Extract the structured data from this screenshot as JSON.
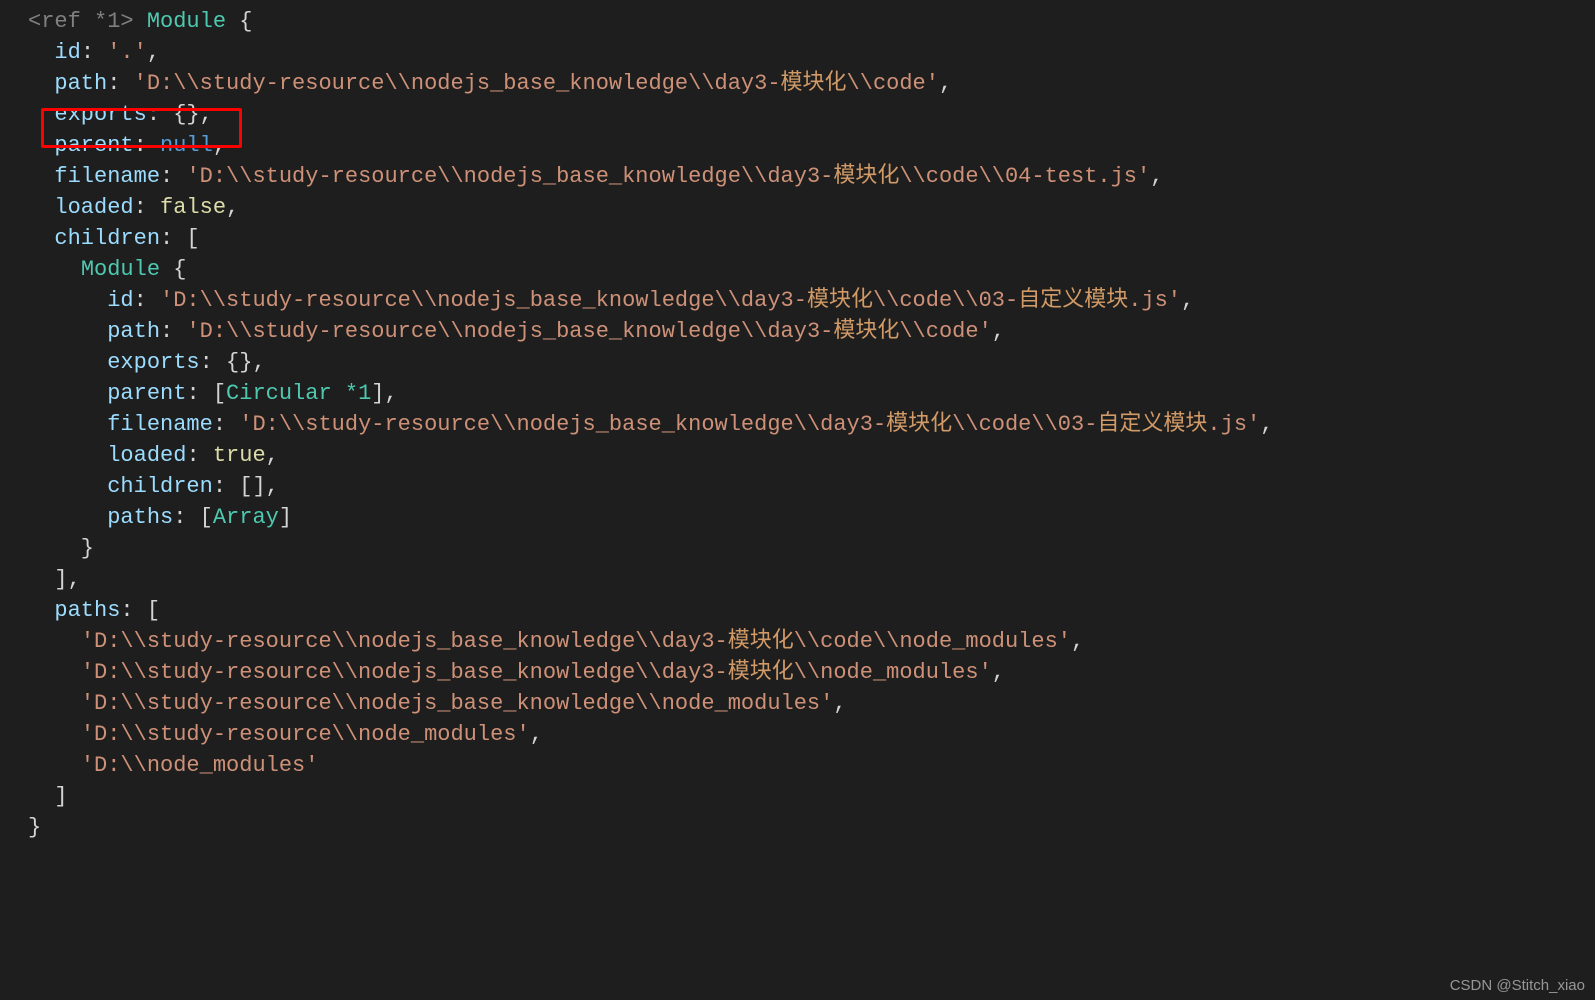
{
  "watermark": "CSDN @Stitch_xiao",
  "code": [
    [
      {
        "cls": "tok-tag",
        "t": "<ref *1>"
      },
      {
        "cls": "tok-punc",
        "t": " "
      },
      {
        "cls": "tok-class",
        "t": "Module"
      },
      {
        "cls": "tok-punc",
        "t": " {"
      }
    ],
    [
      {
        "cls": "tok-punc",
        "t": "  "
      },
      {
        "cls": "tok-key",
        "t": "id"
      },
      {
        "cls": "tok-punc",
        "t": ": "
      },
      {
        "cls": "tok-str",
        "t": "'.'"
      },
      {
        "cls": "tok-punc",
        "t": ","
      }
    ],
    [
      {
        "cls": "tok-punc",
        "t": "  "
      },
      {
        "cls": "tok-key",
        "t": "path"
      },
      {
        "cls": "tok-punc",
        "t": ": "
      },
      {
        "cls": "tok-str",
        "t": "'D:\\\\study-resource\\\\nodejs_base_knowledge\\\\day3-"
      },
      {
        "cls": "tok-strcjk",
        "t": "模块化"
      },
      {
        "cls": "tok-str",
        "t": "\\\\code'"
      },
      {
        "cls": "tok-punc",
        "t": ","
      }
    ],
    [
      {
        "cls": "tok-punc",
        "t": "  "
      },
      {
        "cls": "tok-key",
        "t": "exports"
      },
      {
        "cls": "tok-punc",
        "t": ": {},"
      }
    ],
    [
      {
        "cls": "tok-punc",
        "t": "  "
      },
      {
        "cls": "tok-key",
        "t": "parent"
      },
      {
        "cls": "tok-punc",
        "t": ": "
      },
      {
        "cls": "tok-kw",
        "t": "null"
      },
      {
        "cls": "tok-punc",
        "t": ","
      }
    ],
    [
      {
        "cls": "tok-punc",
        "t": "  "
      },
      {
        "cls": "tok-key",
        "t": "filename"
      },
      {
        "cls": "tok-punc",
        "t": ": "
      },
      {
        "cls": "tok-str",
        "t": "'D:\\\\study-resource\\\\nodejs_base_knowledge\\\\day3-"
      },
      {
        "cls": "tok-strcjk",
        "t": "模块化"
      },
      {
        "cls": "tok-str",
        "t": "\\\\code\\\\04-test.js'"
      },
      {
        "cls": "tok-punc",
        "t": ","
      }
    ],
    [
      {
        "cls": "tok-punc",
        "t": "  "
      },
      {
        "cls": "tok-key",
        "t": "loaded"
      },
      {
        "cls": "tok-punc",
        "t": ": "
      },
      {
        "cls": "tok-bool",
        "t": "false"
      },
      {
        "cls": "tok-punc",
        "t": ","
      }
    ],
    [
      {
        "cls": "tok-punc",
        "t": "  "
      },
      {
        "cls": "tok-key",
        "t": "children"
      },
      {
        "cls": "tok-punc",
        "t": ": ["
      }
    ],
    [
      {
        "cls": "tok-punc",
        "t": "    "
      },
      {
        "cls": "tok-class",
        "t": "Module"
      },
      {
        "cls": "tok-punc",
        "t": " {"
      }
    ],
    [
      {
        "cls": "tok-punc",
        "t": "      "
      },
      {
        "cls": "tok-key",
        "t": "id"
      },
      {
        "cls": "tok-punc",
        "t": ": "
      },
      {
        "cls": "tok-str",
        "t": "'D:\\\\study-resource\\\\nodejs_base_knowledge\\\\day3-"
      },
      {
        "cls": "tok-strcjk",
        "t": "模块化"
      },
      {
        "cls": "tok-str",
        "t": "\\\\code\\\\03-"
      },
      {
        "cls": "tok-strcjk",
        "t": "自定义模块"
      },
      {
        "cls": "tok-str",
        "t": ".js'"
      },
      {
        "cls": "tok-punc",
        "t": ","
      }
    ],
    [
      {
        "cls": "tok-punc",
        "t": "      "
      },
      {
        "cls": "tok-key",
        "t": "path"
      },
      {
        "cls": "tok-punc",
        "t": ": "
      },
      {
        "cls": "tok-str",
        "t": "'D:\\\\study-resource\\\\nodejs_base_knowledge\\\\day3-"
      },
      {
        "cls": "tok-strcjk",
        "t": "模块化"
      },
      {
        "cls": "tok-str",
        "t": "\\\\code'"
      },
      {
        "cls": "tok-punc",
        "t": ","
      }
    ],
    [
      {
        "cls": "tok-punc",
        "t": "      "
      },
      {
        "cls": "tok-key",
        "t": "exports"
      },
      {
        "cls": "tok-punc",
        "t": ": {},"
      }
    ],
    [
      {
        "cls": "tok-punc",
        "t": "      "
      },
      {
        "cls": "tok-key",
        "t": "parent"
      },
      {
        "cls": "tok-punc",
        "t": ": ["
      },
      {
        "cls": "tok-type",
        "t": "Circular *1"
      },
      {
        "cls": "tok-punc",
        "t": "],"
      }
    ],
    [
      {
        "cls": "tok-punc",
        "t": "      "
      },
      {
        "cls": "tok-key",
        "t": "filename"
      },
      {
        "cls": "tok-punc",
        "t": ": "
      },
      {
        "cls": "tok-str",
        "t": "'D:\\\\study-resource\\\\nodejs_base_knowledge\\\\day3-"
      },
      {
        "cls": "tok-strcjk",
        "t": "模块化"
      },
      {
        "cls": "tok-str",
        "t": "\\\\code\\\\03-"
      },
      {
        "cls": "tok-strcjk",
        "t": "自定义模块"
      },
      {
        "cls": "tok-str",
        "t": ".js'"
      },
      {
        "cls": "tok-punc",
        "t": ","
      }
    ],
    [
      {
        "cls": "tok-punc",
        "t": "      "
      },
      {
        "cls": "tok-key",
        "t": "loaded"
      },
      {
        "cls": "tok-punc",
        "t": ": "
      },
      {
        "cls": "tok-bool",
        "t": "true"
      },
      {
        "cls": "tok-punc",
        "t": ","
      }
    ],
    [
      {
        "cls": "tok-punc",
        "t": "      "
      },
      {
        "cls": "tok-key",
        "t": "children"
      },
      {
        "cls": "tok-punc",
        "t": ": [],"
      }
    ],
    [
      {
        "cls": "tok-punc",
        "t": "      "
      },
      {
        "cls": "tok-key",
        "t": "paths"
      },
      {
        "cls": "tok-punc",
        "t": ": ["
      },
      {
        "cls": "tok-type",
        "t": "Array"
      },
      {
        "cls": "tok-punc",
        "t": "]"
      }
    ],
    [
      {
        "cls": "tok-punc",
        "t": "    }"
      }
    ],
    [
      {
        "cls": "tok-punc",
        "t": "  ],"
      }
    ],
    [
      {
        "cls": "tok-punc",
        "t": "  "
      },
      {
        "cls": "tok-key",
        "t": "paths"
      },
      {
        "cls": "tok-punc",
        "t": ": ["
      }
    ],
    [
      {
        "cls": "tok-punc",
        "t": "    "
      },
      {
        "cls": "tok-str",
        "t": "'D:\\\\study-resource\\\\nodejs_base_knowledge\\\\day3-"
      },
      {
        "cls": "tok-strcjk",
        "t": "模块化"
      },
      {
        "cls": "tok-str",
        "t": "\\\\code\\\\node_modules'"
      },
      {
        "cls": "tok-punc",
        "t": ","
      }
    ],
    [
      {
        "cls": "tok-punc",
        "t": "    "
      },
      {
        "cls": "tok-str",
        "t": "'D:\\\\study-resource\\\\nodejs_base_knowledge\\\\day3-"
      },
      {
        "cls": "tok-strcjk",
        "t": "模块化"
      },
      {
        "cls": "tok-str",
        "t": "\\\\node_modules'"
      },
      {
        "cls": "tok-punc",
        "t": ","
      }
    ],
    [
      {
        "cls": "tok-punc",
        "t": "    "
      },
      {
        "cls": "tok-str",
        "t": "'D:\\\\study-resource\\\\nodejs_base_knowledge\\\\node_modules'"
      },
      {
        "cls": "tok-punc",
        "t": ","
      }
    ],
    [
      {
        "cls": "tok-punc",
        "t": "    "
      },
      {
        "cls": "tok-str",
        "t": "'D:\\\\study-resource\\\\node_modules'"
      },
      {
        "cls": "tok-punc",
        "t": ","
      }
    ],
    [
      {
        "cls": "tok-punc",
        "t": "    "
      },
      {
        "cls": "tok-str",
        "t": "'D:\\\\node_modules'"
      }
    ],
    [
      {
        "cls": "tok-punc",
        "t": "  ]"
      }
    ],
    [
      {
        "cls": "tok-punc",
        "t": "}"
      }
    ]
  ]
}
